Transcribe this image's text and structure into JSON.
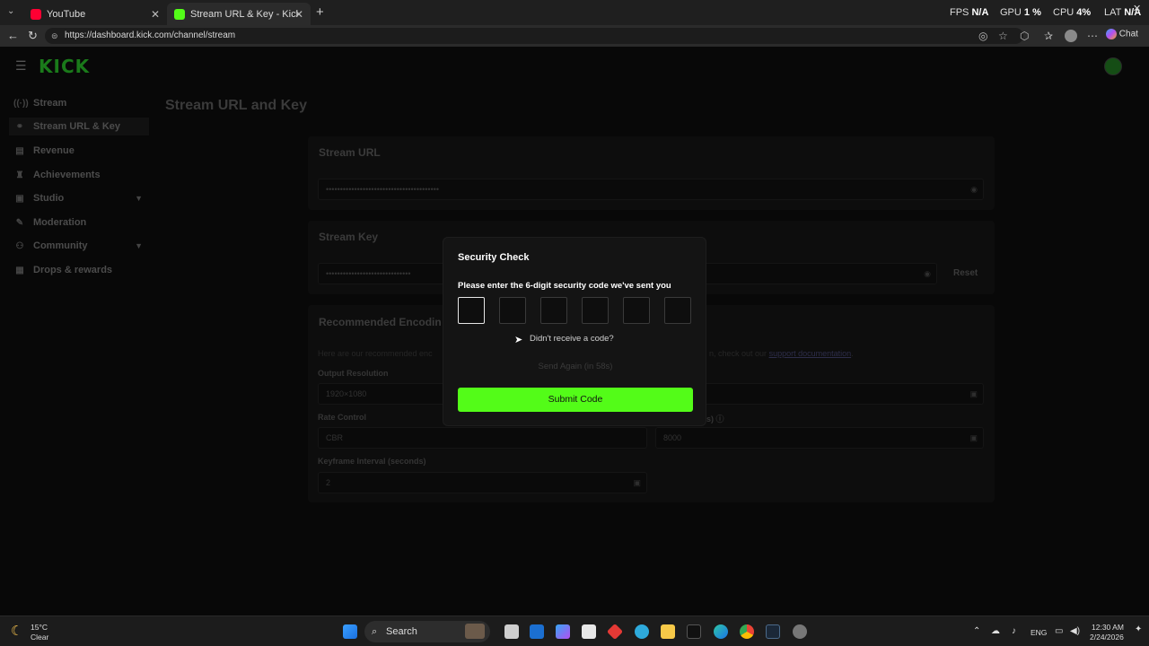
{
  "browser": {
    "tabs": [
      {
        "title": "YouTube",
        "active": false
      },
      {
        "title": "Stream URL & Key - Kick Dashboa",
        "active": true
      }
    ],
    "new_tab": "+",
    "perf": [
      {
        "label": "FPS",
        "value": "N/A"
      },
      {
        "label": "GPU",
        "value": "1 %"
      },
      {
        "label": "CPU",
        "value": "4%"
      },
      {
        "label": "LAT",
        "value": "N/A"
      }
    ],
    "url": "https://dashboard.kick.com/channel/stream",
    "chat_label": "Chat"
  },
  "app": {
    "logo": "KICK",
    "sidebar": [
      {
        "label": "Stream",
        "icon": "broadcast-icon"
      },
      {
        "label": "Stream URL & Key",
        "icon": "link-icon",
        "active": true
      },
      {
        "label": "Revenue",
        "icon": "revenue-icon"
      },
      {
        "label": "Achievements",
        "icon": "trophy-icon"
      },
      {
        "label": "Studio",
        "icon": "studio-icon",
        "expandable": true
      },
      {
        "label": "Moderation",
        "icon": "wrench-icon"
      },
      {
        "label": "Community",
        "icon": "community-icon",
        "expandable": true
      },
      {
        "label": "Drops & rewards",
        "icon": "gift-icon"
      }
    ],
    "page_title": "Stream URL and Key",
    "stream_url": {
      "title": "Stream URL",
      "value": "••••••••••••••••••••••••••••••••••••••••"
    },
    "stream_key": {
      "title": "Stream Key",
      "value": "••••••••••••••••••••••••••••••",
      "reset": "Reset"
    },
    "encoding": {
      "title": "Recommended Encodin",
      "desc_left": "Here are our recommended enc",
      "desc_right": "n, check out our",
      "link": "support documentation",
      "link_end": ".",
      "output_resolution": {
        "label": "Output Resolution",
        "value": "1920×1080"
      },
      "rate_control": {
        "label": "Rate Control",
        "value": "CBR"
      },
      "bitrate": {
        "label": "s)",
        "value": "8000"
      },
      "keyframe": {
        "label": "Keyframe Interval (seconds)",
        "value": "2"
      }
    }
  },
  "modal": {
    "title": "Security Check",
    "prompt": "Please enter the 6-digit security code we've sent you",
    "digits": [
      "",
      "",
      "",
      "",
      "",
      ""
    ],
    "resend_question": "Didn't receive a code?",
    "resend_button": "Send Again (in 58s)",
    "submit": "Submit Code"
  },
  "taskbar": {
    "weather_temp": "15°C",
    "weather_desc": "Clear",
    "search_label": "Search",
    "lang": "ENG",
    "time": "12:30 AM",
    "date": "2/24/2026"
  }
}
